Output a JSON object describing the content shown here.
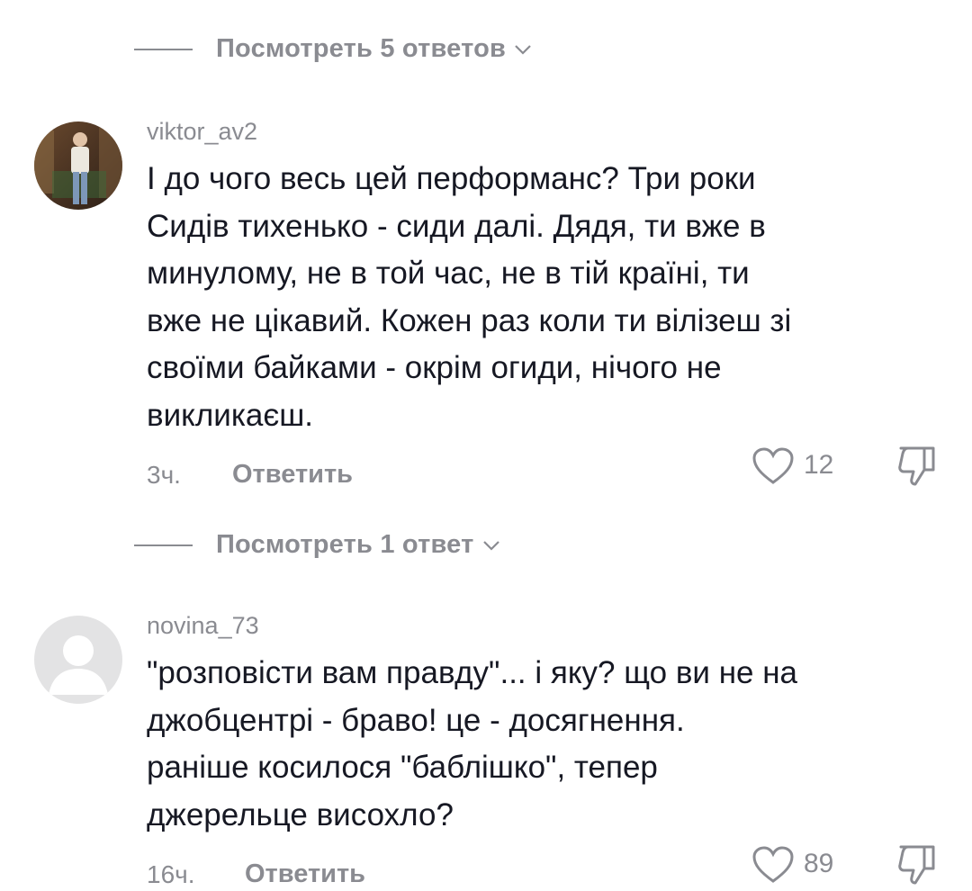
{
  "thread": {
    "view_replies_1": "Посмотреть 5 ответов",
    "view_replies_2": "Посмотреть 1 ответ"
  },
  "comments": [
    {
      "username": "viktor_av2",
      "text": "І до чого весь цей перформанс? Три роки\nСидів тихенько - сиди далі. Дядя, ти вже в\nминулому, не в той час, не в тій країні, ти\nвже не цікавий. Кожен раз коли ти вілізеш зі\nсвоїми байками - окрім огиди, нічого не\nвикликаєш.",
      "time": "3ч.",
      "reply_label": "Ответить",
      "likes": "12",
      "avatar": "user-photo"
    },
    {
      "username": "novina_73",
      "text": "\"розповісти вам правду\"... і яку? що ви не на\nджобцентрі - браво! це - досягнення.\nраніше косилося \"баблішко\", тепер\nджерельце висохло?",
      "time": "16ч.",
      "reply_label": "Ответить",
      "likes": "89",
      "avatar": "default-avatar"
    }
  ],
  "icons": [
    "heart-icon",
    "dislike-icon",
    "chevron-down-icon"
  ],
  "colors": {
    "muted": "#8a8b91",
    "text": "#161823",
    "background": "#ffffff"
  }
}
